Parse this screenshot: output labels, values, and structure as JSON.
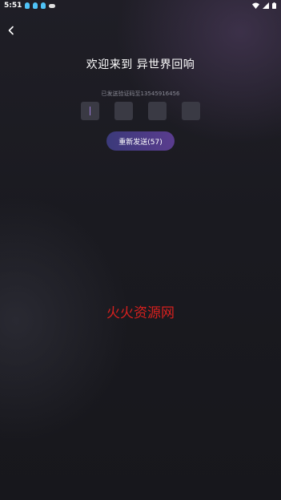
{
  "status_bar": {
    "time": "5:51",
    "notification_icons": [
      "qq-icon",
      "qq-icon",
      "qq-icon",
      "cloud-icon"
    ],
    "right_icons": [
      "wifi-icon",
      "signal-icon",
      "battery-icon"
    ]
  },
  "header": {
    "back_icon": "chevron-left-icon",
    "title": "欢迎来到 异世界回响"
  },
  "verification": {
    "hint": "已发送验证码至13545916456",
    "code_digits": [
      "",
      "",
      "",
      ""
    ],
    "caret_color": "#9c7cd8"
  },
  "resend": {
    "label": "重新发送(57)"
  },
  "watermark": {
    "text": "火火资源网",
    "color": "#d6201e"
  }
}
